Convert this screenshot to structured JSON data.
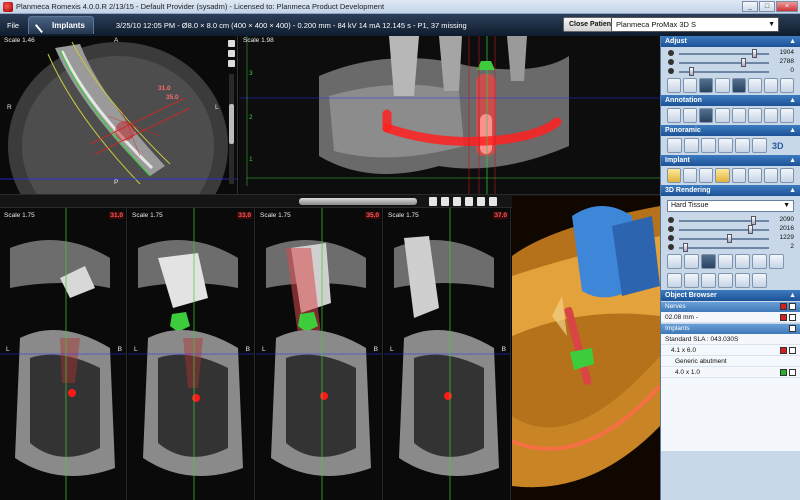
{
  "window": {
    "title": "Planmeca Romexis 4.0.0.R  2/13/15 - Default Provider (sysadm) - Licensed to: Planmeca Product Development",
    "buttons": [
      "_",
      "□",
      "×"
    ]
  },
  "toolbar": {
    "file_menu": "File",
    "module_tab": "Implants",
    "scan_info": "3/25/10 12:05 PM - Ø8.0 × 8.0 cm (400 × 400 × 400) - 0.200 mm - 84 kV 14 mA 12.145 s - P1, 37 missing",
    "close_patient": "Close Patient",
    "device": "Planmeca ProMax 3D S"
  },
  "views": {
    "axial": {
      "scale": "Scale 1.46",
      "top": "A",
      "bottom": "P",
      "left": "R",
      "right": "L",
      "marker1": "31.0",
      "marker2": "35.0"
    },
    "panoramic": {
      "scale": "Scale 1.98",
      "ticks": [
        "3",
        "2",
        "1"
      ]
    },
    "cross_sections": [
      {
        "scale": "Scale 1.75",
        "num": "31.0",
        "left": "L",
        "right": "B"
      },
      {
        "scale": "Scale 1.75",
        "num": "33.0",
        "left": "L",
        "right": "B"
      },
      {
        "scale": "Scale 1.75",
        "num": "35.0",
        "left": "L",
        "right": "B"
      },
      {
        "scale": "Scale 1.75",
        "num": "37.0",
        "left": "L",
        "right": "B"
      }
    ]
  },
  "sidebar": {
    "adjust": {
      "title": "Adjust",
      "sliders": [
        {
          "value": "1904",
          "pos": 0.85
        },
        {
          "value": "2788",
          "pos": 0.72
        },
        {
          "value": "0",
          "pos": 0.12
        }
      ]
    },
    "annotation": {
      "title": "Annotation"
    },
    "panoramic": {
      "title": "Panoramic",
      "label_3d": "3D"
    },
    "implant": {
      "title": "Implant"
    },
    "rendering": {
      "title": "3D Rendering",
      "mode": "Hard Tissue",
      "sliders": [
        {
          "value": "2090",
          "pos": 0.84
        },
        {
          "value": "2016",
          "pos": 0.8
        },
        {
          "value": "1229",
          "pos": 0.56
        },
        {
          "value": "2",
          "pos": 0.05
        }
      ]
    },
    "object_browser": {
      "title": "Object Browser",
      "nerves_label": "Nerves",
      "nerve_item": "02.08 mm -",
      "implants_label": "Implants",
      "implant_name": "Standard SLA : 043.030S",
      "implant_size": "4.1 x 6.0",
      "abutment_name": "Generic abutment",
      "abutment_size": "4.0 x 1.0"
    }
  },
  "colors": {
    "accent": "#1d5296",
    "implant_green": "#3ccc3c",
    "nerve_red": "#e02020"
  }
}
